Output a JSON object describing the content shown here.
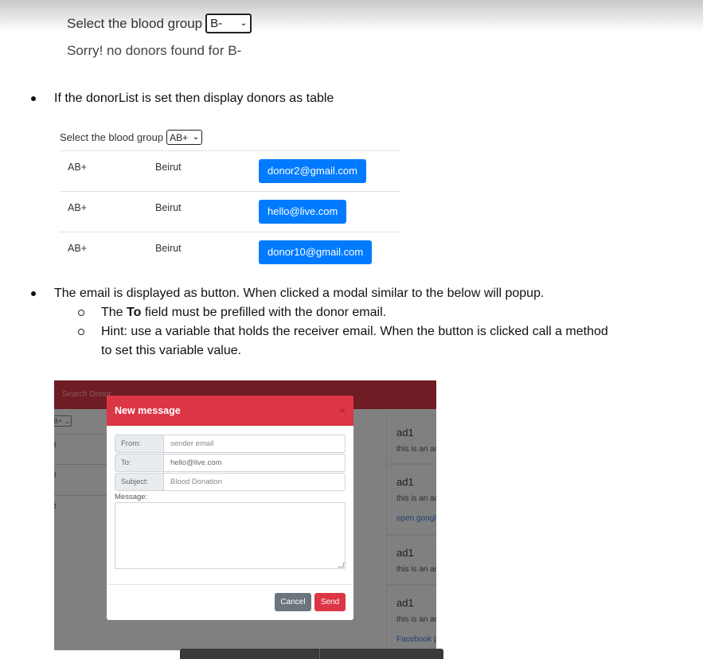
{
  "section_no_donors": {
    "select_label": "Select the blood group",
    "selected_group": "B-",
    "message": "Sorry! no donors found for B-"
  },
  "bullets": {
    "b1": "If the donorList is set then display donors as table",
    "b2": "The email is displayed as button. When clicked a modal similar to the below will popup.",
    "b2_sub1_pre": "The ",
    "b2_sub1_bold": "To",
    "b2_sub1_post": " field must be prefilled with the donor email.",
    "b2_sub2_line1": "Hint: use a variable that holds the receiver email. When the button is clicked call a method",
    "b2_sub2_line2": "to set this variable value."
  },
  "donor_table": {
    "select_label": "Select the blood group",
    "selected_group": "AB+",
    "rows": [
      {
        "group": "AB+",
        "city": "Beirut",
        "email": "donor2@gmail.com"
      },
      {
        "group": "AB+",
        "city": "Beirut",
        "email": "hello@live.com"
      },
      {
        "group": "AB+",
        "city": "Beirut",
        "email": "donor10@gmail.com"
      }
    ]
  },
  "modal_screenshot": {
    "navbar_brand": "Search Donor",
    "bg_select": "B+",
    "bg_row_char": "t",
    "modal": {
      "title": "New message",
      "close_icon": "×",
      "fields": [
        {
          "label": "From:",
          "value": "sender email",
          "placeholder": true
        },
        {
          "label": "To:",
          "value": "hello@live.com",
          "placeholder": false
        },
        {
          "label": "Subject:",
          "value": "Blood Donation",
          "placeholder": true
        }
      ],
      "message_label": "Message:",
      "message_value": "",
      "cancel_label": "Cancel",
      "send_label": "Send"
    },
    "ads": [
      {
        "title": "ad1",
        "desc": "this is an ad",
        "link": ""
      },
      {
        "title": "ad1",
        "desc": "this is an ad",
        "link": "open google"
      },
      {
        "title": "ad1",
        "desc": "this is an ad",
        "link": ""
      },
      {
        "title": "ad1",
        "desc": "this is an ad",
        "link": "Facebook page"
      }
    ]
  },
  "colors": {
    "primary": "#007bff",
    "danger": "#dc3545",
    "secondary": "#6c757d",
    "navbar": "#6f1c24"
  }
}
